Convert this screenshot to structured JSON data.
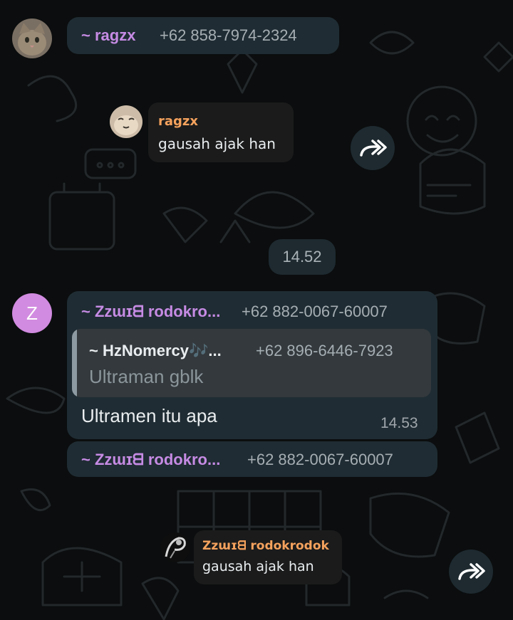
{
  "colors": {
    "background": "#0b0d0e",
    "bubble": "#1f2c33",
    "sender_purple": "#c68be4",
    "sender_orange": "#f5a25d",
    "avatar_z": "#d18be0"
  },
  "messages": {
    "top_header": {
      "sender": "~ ragzx",
      "phone": "+62 858-7974-2324"
    },
    "sticker_reply_1": {
      "sender": "ragzx",
      "text": "gausah ajak han"
    },
    "date_time_pill": "14.52",
    "z_message": {
      "avatar_letter": "Z",
      "sender": "~ Zzɯɪᗺ rodokro...",
      "phone": "+62 882-0067-60007",
      "quoted": {
        "sender": "~ HzNomercy🎶...",
        "phone": "+62 896-6446-7923",
        "text": "Ultraman gblk"
      },
      "text": "Ultramen itu apa",
      "time": "14.53"
    },
    "z_header_2": {
      "sender": "~ Zzɯɪᗺ rodokro...",
      "phone": "+62 882-0067-60007"
    },
    "sticker_reply_2": {
      "sender": "Zzɯɪᗺ rodokrodok",
      "text": "gausah ajak han"
    }
  },
  "icons": {
    "forward": "forward-icon",
    "cat_avatar": "cat-avatar-icon",
    "anime_avatar": "anime-avatar-icon"
  }
}
